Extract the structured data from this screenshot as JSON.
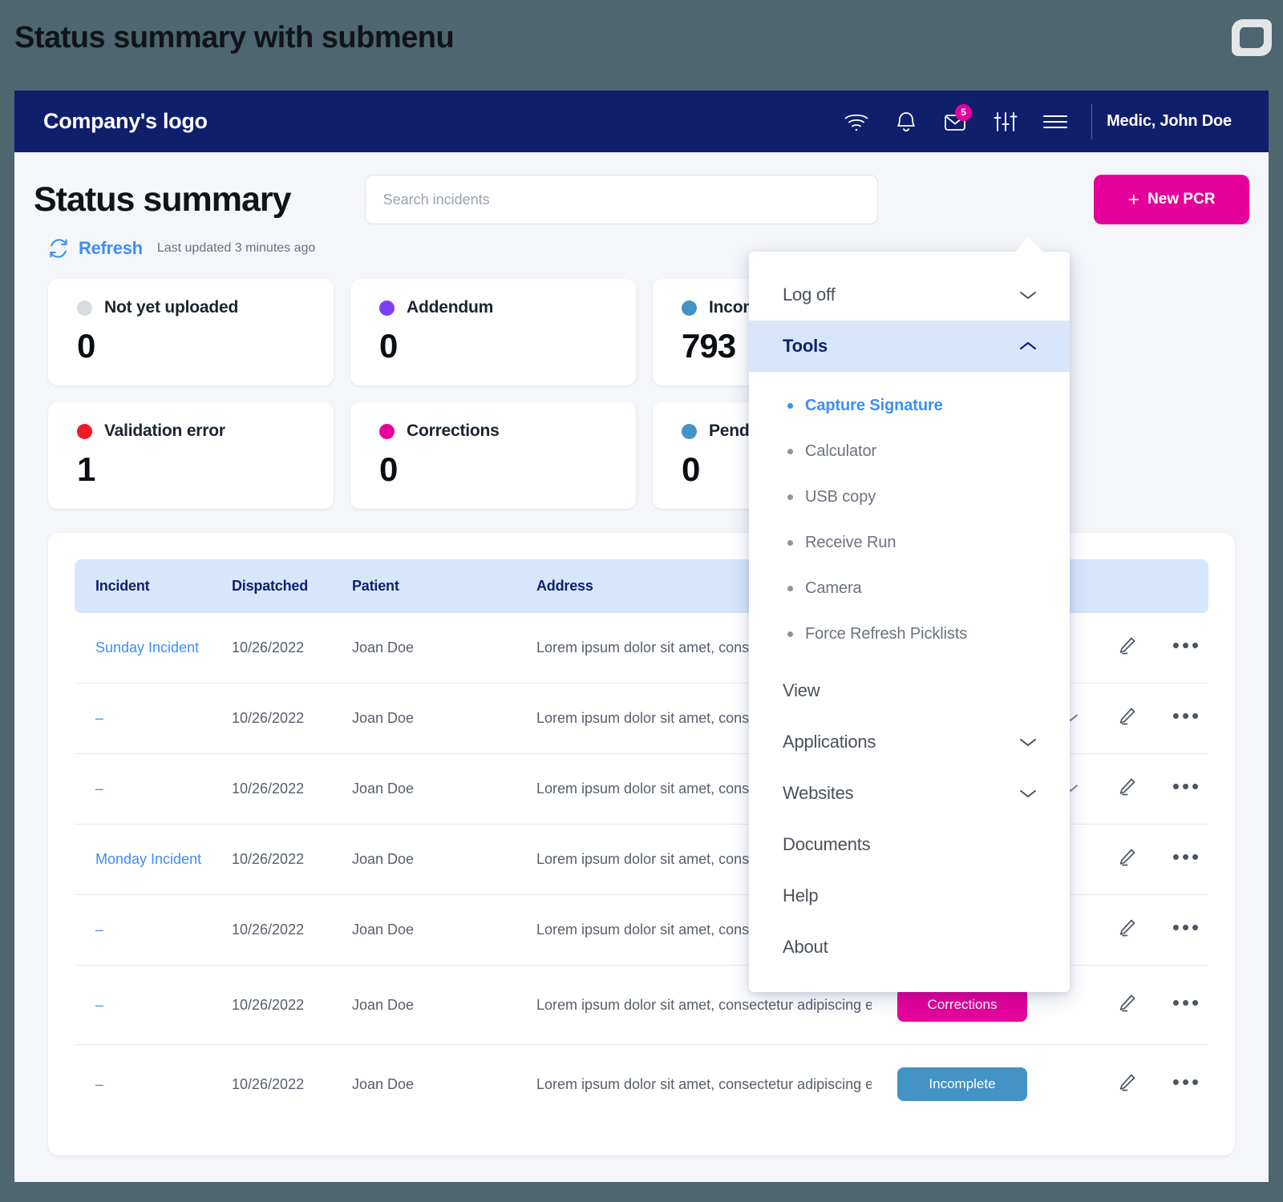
{
  "slide": {
    "title": "Status summary with submenu",
    "brand_icon": "leaf-mark-logo"
  },
  "colors": {
    "navy": "#0f1f6b",
    "magenta": "#e6009b",
    "link_blue": "#3d8ef5",
    "header_blue": "#d7e6fb",
    "slide_bg": "#4d6670"
  },
  "navbar": {
    "logo_text": "Company's logo",
    "icons": [
      {
        "name": "wifi-icon"
      },
      {
        "name": "bell-icon"
      },
      {
        "name": "mail-icon",
        "badge": "5"
      },
      {
        "name": "sliders-icon"
      },
      {
        "name": "hamburger-menu-icon"
      }
    ],
    "user_name": "Medic, John Doe"
  },
  "header": {
    "page_title": "Status summary",
    "search_placeholder": "Search incidents",
    "search_value": "",
    "new_pcr_label": "New PCR",
    "plus_glyph": "+"
  },
  "refresh": {
    "label": "Refresh",
    "last_updated": "Last updated 3 minutes ago"
  },
  "cards": [
    {
      "label": "Not yet uploaded",
      "value": "0",
      "color": "#d8dce2"
    },
    {
      "label": "Addendum",
      "value": "0",
      "color": "#7b3ff2"
    },
    {
      "label": "Incomplete",
      "value": "793",
      "color": "#4393c4"
    },
    {
      "label": "Validation error",
      "value": "1",
      "color": "#ee1b25"
    },
    {
      "label": "Corrections",
      "value": "0",
      "color": "#e6009b"
    },
    {
      "label": "Pending",
      "value": "0",
      "color": "#4393c4"
    }
  ],
  "table": {
    "columns": [
      "Incident",
      "Dispatched",
      "Patient",
      "Address",
      "",
      "",
      "",
      ""
    ],
    "rows": [
      {
        "incident": "Sunday Incident",
        "dispatched": "10/26/2022",
        "patient": "Joan Doe",
        "address": "Lorem ipsum dolor sit amet, consectetur adipiscing elit",
        "status": "",
        "status_kind": ""
      },
      {
        "incident": "–",
        "dispatched": "10/26/2022",
        "patient": "Joan Doe",
        "address": "Lorem ipsum dolor sit amet, consectetur adipiscing elit",
        "status": "",
        "status_kind": ""
      },
      {
        "incident": "–",
        "dispatched": "10/26/2022",
        "patient": "Joan Doe",
        "address": "Lorem ipsum dolor sit amet, consectetur adipiscing elit",
        "status": "",
        "status_kind": ""
      },
      {
        "incident": "Monday Incident",
        "dispatched": "10/26/2022",
        "patient": "Joan Doe",
        "address": "Lorem ipsum dolor sit amet, consectetur adipiscing elit",
        "status": "",
        "status_kind": ""
      },
      {
        "incident": "–",
        "dispatched": "10/26/2022",
        "patient": "Joan Doe",
        "address": "Lorem ipsum dolor sit amet, consectetur adipiscing elit",
        "status": "",
        "status_kind": ""
      },
      {
        "incident": "–",
        "dispatched": "10/26/2022",
        "patient": "Joan Doe",
        "address": "Lorem ipsum dolor sit amet, consectetur adipiscing elit",
        "status": "Corrections",
        "status_kind": "corrections"
      },
      {
        "incident": "–",
        "dispatched": "10/26/2022",
        "patient": "Joan Doe",
        "address": "Lorem ipsum dolor sit amet, consectetur adipiscing elit",
        "status": "Incomplete",
        "status_kind": "incomplete"
      }
    ],
    "row_icons": {
      "edit": "pencil-icon",
      "more": "•••"
    }
  },
  "menu": {
    "items": [
      {
        "label": "Log off",
        "chevron": "down",
        "active": false
      },
      {
        "label": "Tools",
        "chevron": "up",
        "active": true
      },
      {
        "label": "View",
        "chevron": "",
        "active": false
      },
      {
        "label": "Applications",
        "chevron": "down",
        "active": false
      },
      {
        "label": "Websites",
        "chevron": "down",
        "active": false
      },
      {
        "label": "Documents",
        "chevron": "",
        "active": false
      },
      {
        "label": "Help",
        "chevron": "",
        "active": false
      },
      {
        "label": "About",
        "chevron": "",
        "active": false
      }
    ],
    "tools_submenu": [
      {
        "label": "Capture Signature",
        "selected": true
      },
      {
        "label": "Calculator",
        "selected": false
      },
      {
        "label": "USB copy",
        "selected": false
      },
      {
        "label": "Receive Run",
        "selected": false
      },
      {
        "label": "Camera",
        "selected": false
      },
      {
        "label": "Force Refresh Picklists",
        "selected": false
      }
    ]
  }
}
